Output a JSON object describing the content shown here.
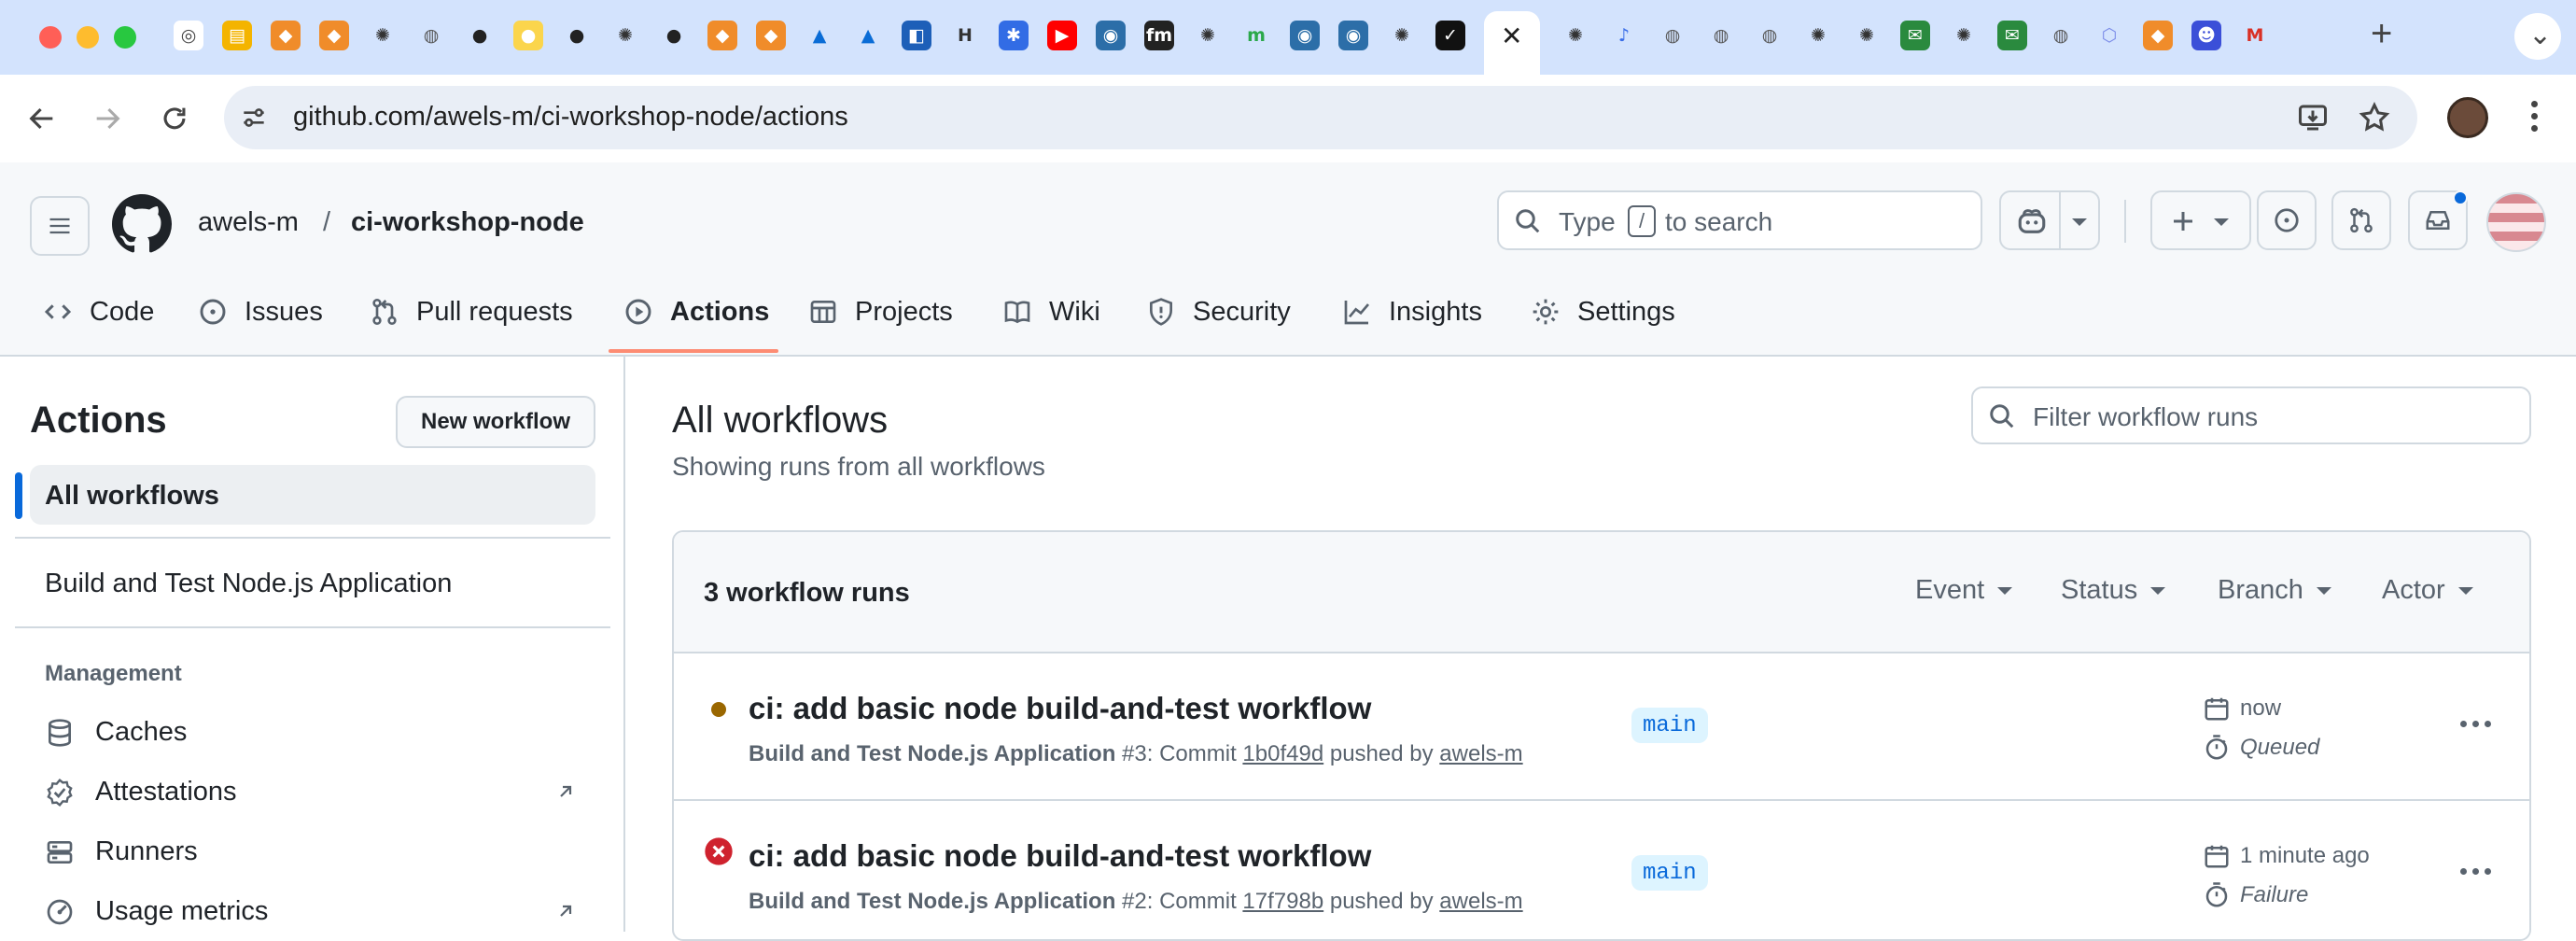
{
  "browser": {
    "url": "github.com/awels-m/ci-workshop-node/actions",
    "tab_close_glyph": "✕",
    "new_tab_glyph": "+",
    "tabs_menu_glyph": "⌄",
    "tab_favicons": [
      "chrome",
      "sheets",
      "box",
      "box",
      "openai",
      "globe",
      "github",
      "bulb",
      "github",
      "openai",
      "github",
      "box",
      "box",
      "azure",
      "azure",
      "vscode",
      "slack-like",
      "kubernetes",
      "youtube",
      "docker",
      "fm",
      "openai",
      "m",
      "docker",
      "docker",
      "openai",
      "claude",
      "active",
      "openai",
      "dot-app",
      "globe",
      "globe",
      "globe",
      "openai",
      "openai",
      "mail-sheet",
      "openai",
      "mail-sheet",
      "globe",
      "cube",
      "box",
      "person",
      "gmail"
    ]
  },
  "header": {
    "owner": "awels-m",
    "separator": "/",
    "repo": "ci-workshop-node",
    "search_prefix": "Type",
    "search_key": "/",
    "search_suffix": "to search"
  },
  "nav": {
    "tabs": [
      {
        "label": "Code",
        "icon": "code-icon"
      },
      {
        "label": "Issues",
        "icon": "issue-icon"
      },
      {
        "label": "Pull requests",
        "icon": "pull-request-icon"
      },
      {
        "label": "Actions",
        "icon": "play-icon",
        "active": true
      },
      {
        "label": "Projects",
        "icon": "table-icon"
      },
      {
        "label": "Wiki",
        "icon": "book-icon"
      },
      {
        "label": "Security",
        "icon": "shield-icon"
      },
      {
        "label": "Insights",
        "icon": "graph-icon"
      },
      {
        "label": "Settings",
        "icon": "gear-icon"
      }
    ]
  },
  "sidebar": {
    "title": "Actions",
    "new_workflow_label": "New workflow",
    "all_workflows_label": "All workflows",
    "workflows": [
      "Build and Test Node.js Application"
    ],
    "management_heading": "Management",
    "management_items": [
      {
        "label": "Caches",
        "icon": "database-icon"
      },
      {
        "label": "Attestations",
        "icon": "verified-icon",
        "external": true
      },
      {
        "label": "Runners",
        "icon": "server-icon"
      },
      {
        "label": "Usage metrics",
        "icon": "meter-icon",
        "external": true
      }
    ]
  },
  "main": {
    "title": "All workflows",
    "subtitle": "Showing runs from all workflows",
    "filter_placeholder": "Filter workflow runs",
    "runs_count": "3 workflow runs",
    "filters": [
      "Event",
      "Status",
      "Branch",
      "Actor"
    ],
    "runs": [
      {
        "title": "ci: add basic node build-and-test workflow",
        "workflow": "Build and Test Node.js Application",
        "number": "#3",
        "commit_label": "Commit",
        "commit": "1b0f49d",
        "pushed_by_label": "pushed by",
        "actor": "awels-m",
        "branch": "main",
        "time": "now",
        "status": "Queued",
        "status_color": "#9a6700"
      },
      {
        "title": "ci: add basic node build-and-test workflow",
        "workflow": "Build and Test Node.js Application",
        "number": "#2",
        "commit_label": "Commit",
        "commit": "17f798b",
        "pushed_by_label": "pushed by",
        "actor": "awels-m",
        "branch": "main",
        "time": "1 minute ago",
        "status": "Failure",
        "status_color": "#cf222e"
      }
    ]
  },
  "colors": {
    "accent": "#fd8c73",
    "link": "#0969da",
    "tabstrip": "#d3e3fd",
    "selected_bar": "#0969da"
  }
}
